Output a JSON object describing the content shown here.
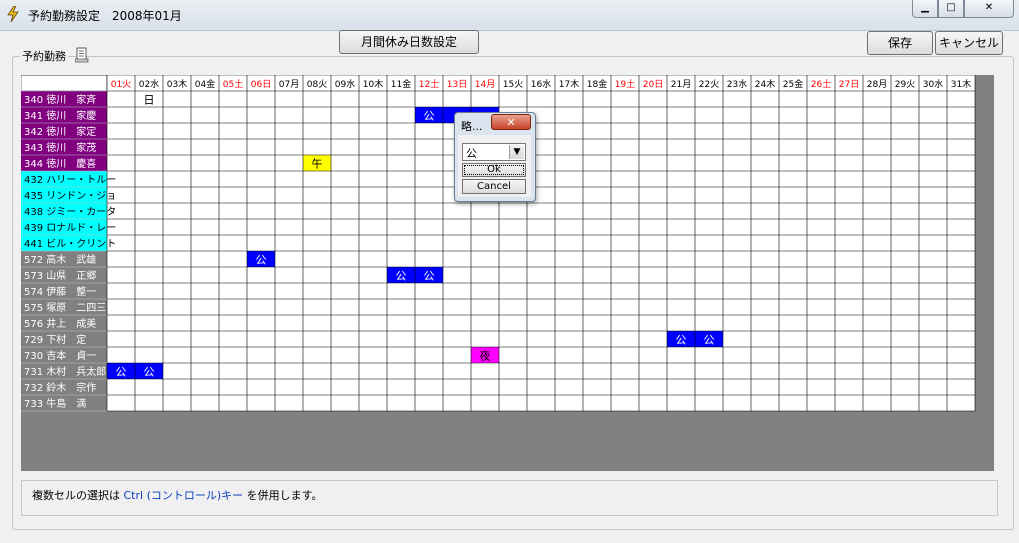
{
  "window": {
    "title": "予約勤務設定　2008年01月",
    "min_label": "▁",
    "max_label": "□",
    "close_label": "✕"
  },
  "toolbar": {
    "monthly_button": "月間休み日数設定",
    "save_button": "保存",
    "cancel_button": "キャンセル"
  },
  "group": {
    "label": "予約勤務"
  },
  "colors": {
    "purple": "#800080",
    "cyan": "#00ffff",
    "gray": "#808080",
    "blue": "#0000ff",
    "yellow": "#ffff00",
    "magenta": "#ff00ff",
    "weekend_red": "#ff0000"
  },
  "days": [
    {
      "label": "01火",
      "red": true
    },
    {
      "label": "02水",
      "red": false
    },
    {
      "label": "03木",
      "red": false
    },
    {
      "label": "04金",
      "red": false
    },
    {
      "label": "05土",
      "red": true
    },
    {
      "label": "06日",
      "red": true
    },
    {
      "label": "07月",
      "red": false
    },
    {
      "label": "08火",
      "red": false
    },
    {
      "label": "09水",
      "red": false
    },
    {
      "label": "10木",
      "red": false
    },
    {
      "label": "11金",
      "red": false
    },
    {
      "label": "12土",
      "red": true
    },
    {
      "label": "13日",
      "red": true
    },
    {
      "label": "14月",
      "red": true
    },
    {
      "label": "15火",
      "red": false
    },
    {
      "label": "16水",
      "red": false
    },
    {
      "label": "17木",
      "red": false
    },
    {
      "label": "18金",
      "red": false
    },
    {
      "label": "19土",
      "red": true
    },
    {
      "label": "20日",
      "red": true
    },
    {
      "label": "21月",
      "red": false
    },
    {
      "label": "22火",
      "red": false
    },
    {
      "label": "23水",
      "red": false
    },
    {
      "label": "24木",
      "red": false
    },
    {
      "label": "25金",
      "red": false
    },
    {
      "label": "26土",
      "red": true
    },
    {
      "label": "27日",
      "red": true
    },
    {
      "label": "28月",
      "red": false
    },
    {
      "label": "29火",
      "red": false
    },
    {
      "label": "30水",
      "red": false
    },
    {
      "label": "31木",
      "red": false
    }
  ],
  "employees": [
    {
      "label": "340 徳川　家斉",
      "group": "purple"
    },
    {
      "label": "341 徳川　家慶",
      "group": "purple"
    },
    {
      "label": "342 徳川　家定",
      "group": "purple"
    },
    {
      "label": "343 徳川　家茂",
      "group": "purple"
    },
    {
      "label": "344 徳川　慶喜",
      "group": "purple"
    },
    {
      "label": "432 ハリー・トルー",
      "group": "cyan"
    },
    {
      "label": "435 リンドン・ジョ",
      "group": "cyan"
    },
    {
      "label": "438 ジミー・カータ",
      "group": "cyan"
    },
    {
      "label": "439 ロナルド・レー",
      "group": "cyan"
    },
    {
      "label": "441 ビル・クリント",
      "group": "cyan"
    },
    {
      "label": "572 高木　武雄",
      "group": "gray"
    },
    {
      "label": "573 山県　正郷",
      "group": "gray"
    },
    {
      "label": "574 伊藤　整一",
      "group": "gray"
    },
    {
      "label": "575 塚原　二四三",
      "group": "gray"
    },
    {
      "label": "576 井上　成美",
      "group": "gray"
    },
    {
      "label": "729 下村　定",
      "group": "gray"
    },
    {
      "label": "730 吉本　貞一",
      "group": "gray"
    },
    {
      "label": "731 木村　兵太郎",
      "group": "gray"
    },
    {
      "label": "732 鈴木　宗作",
      "group": "gray"
    },
    {
      "label": "733 牛島　満",
      "group": "gray"
    }
  ],
  "cells": [
    {
      "row": 0,
      "day": 1,
      "text": "日",
      "style": "plain"
    },
    {
      "row": 1,
      "day": 11,
      "text": "公",
      "style": "blue"
    },
    {
      "row": 1,
      "day": 12,
      "text": "",
      "style": "blue"
    },
    {
      "row": 1,
      "day": 13,
      "text": "",
      "style": "blue"
    },
    {
      "row": 4,
      "day": 7,
      "text": "午",
      "style": "yellow"
    },
    {
      "row": 10,
      "day": 5,
      "text": "公",
      "style": "blue"
    },
    {
      "row": 11,
      "day": 10,
      "text": "公",
      "style": "blue"
    },
    {
      "row": 11,
      "day": 11,
      "text": "公",
      "style": "blue"
    },
    {
      "row": 15,
      "day": 20,
      "text": "公",
      "style": "blue"
    },
    {
      "row": 15,
      "day": 21,
      "text": "公",
      "style": "blue"
    },
    {
      "row": 16,
      "day": 13,
      "text": "夜",
      "style": "magenta"
    },
    {
      "row": 17,
      "day": 0,
      "text": "公",
      "style": "blue"
    },
    {
      "row": 17,
      "day": 1,
      "text": "公",
      "style": "blue"
    }
  ],
  "dialog": {
    "title": "略...",
    "close_label": "✕",
    "selected": "公",
    "ok_label": "Ok",
    "cancel_label": "Cancel"
  },
  "status": {
    "text_before": "複数セルの選択は ",
    "text_em": "Ctrl (コントロール)キー",
    "text_after": " を併用します。"
  }
}
